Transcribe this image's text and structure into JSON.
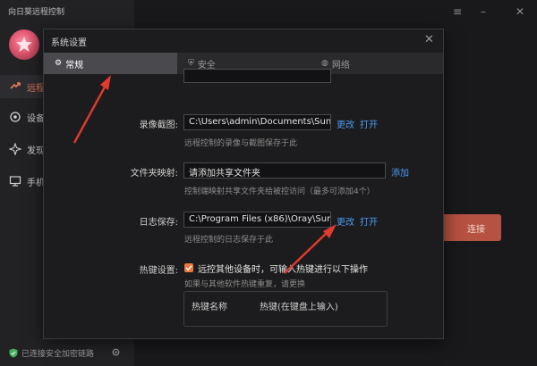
{
  "app": {
    "title": "向日葵远程控制",
    "nav": [
      {
        "label": "远程",
        "icon": "remote-icon"
      },
      {
        "label": "设备",
        "icon": "device-icon"
      },
      {
        "label": "发现",
        "icon": "discover-icon"
      },
      {
        "label": "手机",
        "icon": "monitor-icon"
      }
    ],
    "status": "已连接安全加密链路",
    "connect_label": "连接",
    "window_controls": {
      "menu": "≡",
      "minimize": "–",
      "close": "✕"
    }
  },
  "dialog": {
    "title": "系统设置",
    "close": "✕",
    "tabs": [
      {
        "label": "常规",
        "icon": "gear-icon",
        "active": true
      },
      {
        "label": "安全",
        "icon": "shield-icon",
        "active": false
      },
      {
        "label": "网络",
        "icon": "globe-icon",
        "active": false
      }
    ],
    "recording": {
      "label": "录像截图:",
      "path": "C:\\Users\\admin\\Documents\\Sun",
      "change": "更改",
      "open": "打开",
      "hint": "远程控制的录像与截图保存于此"
    },
    "shared_folder": {
      "label": "文件夹映射:",
      "placeholder": "请添加共享文件夹",
      "add": "添加",
      "hint": "控制端映射共享文件夹给被控访问（最多可添加4个）"
    },
    "log": {
      "label": "日志保存:",
      "path": "C:\\Program Files (x86)\\Oray\\Sun",
      "change": "更改",
      "open": "打开",
      "hint": "远程控制的日志保存于此"
    },
    "hotkey": {
      "label": "热键设置:",
      "option": "远控其他设备时，可输入热键进行以下操作",
      "hint": "如果与其他软件热键重复，请更换",
      "col_name": "热键名称",
      "col_key": "热键(在键盘上输入)"
    }
  }
}
